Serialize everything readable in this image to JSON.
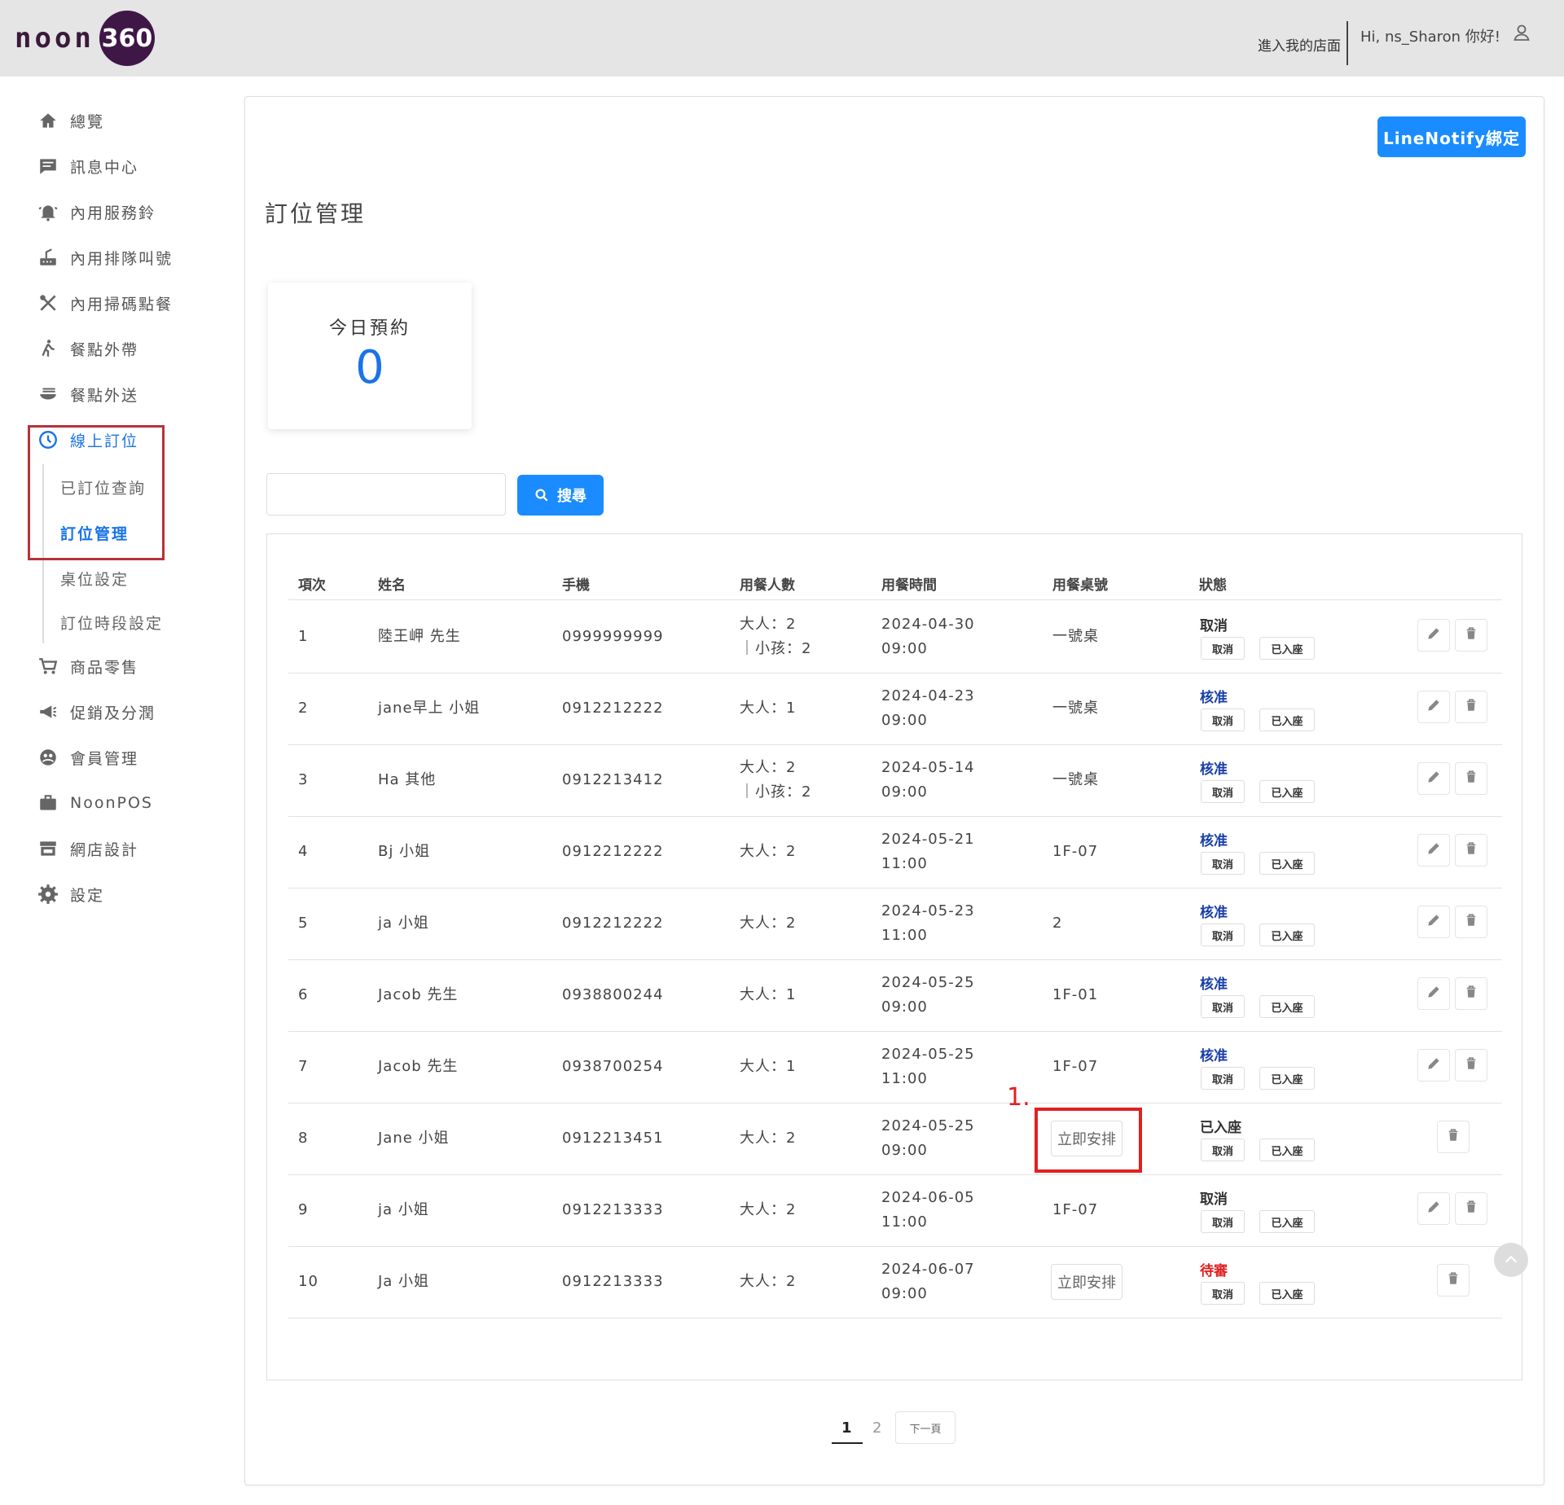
{
  "header": {
    "logo_text": "noon",
    "logo_badge": "360",
    "store_link": "進入我的店面",
    "greeting": "Hi, ns_Sharon 你好!"
  },
  "sidebar": {
    "items": [
      {
        "label": "總覽",
        "icon": "home-icon"
      },
      {
        "label": "訊息中心",
        "icon": "message-icon"
      },
      {
        "label": "內用服務鈴",
        "icon": "bell-icon"
      },
      {
        "label": "內用排隊叫號",
        "icon": "queue-icon"
      },
      {
        "label": "內用掃碼點餐",
        "icon": "utensils-icon"
      },
      {
        "label": "餐點外帶",
        "icon": "walk-icon"
      },
      {
        "label": "餐點外送",
        "icon": "bowl-icon"
      },
      {
        "label": "線上訂位",
        "icon": "clock-icon"
      },
      {
        "label": "商品零售",
        "icon": "cart-icon"
      },
      {
        "label": "促銷及分潤",
        "icon": "megaphone-icon"
      },
      {
        "label": "會員管理",
        "icon": "member-icon"
      },
      {
        "label": "NoonPOS",
        "icon": "briefcase-icon"
      },
      {
        "label": "網店設計",
        "icon": "store-icon"
      },
      {
        "label": "設定",
        "icon": "gear-icon"
      }
    ],
    "sub_items": [
      "已訂位查詢",
      "訂位管理",
      "桌位設定",
      "訂位時段設定"
    ]
  },
  "main": {
    "line_button": "LineNotify綁定",
    "title": "訂位管理",
    "today_label": "今日預約",
    "today_value": "0",
    "search_placeholder": "",
    "search_button": "搜尋"
  },
  "table": {
    "headers": [
      "項次",
      "姓名",
      "手機",
      "用餐人數",
      "用餐時間",
      "用餐桌號",
      "狀態"
    ],
    "cancel_label": "取消",
    "seated_label": "已入座",
    "arrange_label": "立即安排",
    "rows": [
      {
        "no": "1",
        "name": "陸王岬 先生",
        "phone": "0999999999",
        "party1": "大人：2",
        "party2": "｜小孩：2",
        "date": "2024-04-30",
        "time": "09:00",
        "table": "一號桌",
        "status": "取消",
        "status_color": "#333333"
      },
      {
        "no": "2",
        "name": "jane早上 小姐",
        "phone": "0912212222",
        "party1": "大人：1",
        "party2": "",
        "date": "2024-04-23",
        "time": "09:00",
        "table": "一號桌",
        "status": "核准",
        "status_color": "#1a3fa8"
      },
      {
        "no": "3",
        "name": "Ha 其他",
        "phone": "0912213412",
        "party1": "大人：2",
        "party2": "｜小孩：2",
        "date": "2024-05-14",
        "time": "09:00",
        "table": "一號桌",
        "status": "核准",
        "status_color": "#1a3fa8"
      },
      {
        "no": "4",
        "name": "Bj 小姐",
        "phone": "0912212222",
        "party1": "大人：2",
        "party2": "",
        "date": "2024-05-21",
        "time": "11:00",
        "table": "1F-07",
        "status": "核准",
        "status_color": "#1a3fa8"
      },
      {
        "no": "5",
        "name": "ja 小姐",
        "phone": "0912212222",
        "party1": "大人：2",
        "party2": "",
        "date": "2024-05-23",
        "time": "11:00",
        "table": "2",
        "status": "核准",
        "status_color": "#1a3fa8"
      },
      {
        "no": "6",
        "name": "Jacob 先生",
        "phone": "0938800244",
        "party1": "大人：1",
        "party2": "",
        "date": "2024-05-25",
        "time": "09:00",
        "table": "1F-01",
        "status": "核准",
        "status_color": "#1a3fa8"
      },
      {
        "no": "7",
        "name": "Jacob 先生",
        "phone": "0938700254",
        "party1": "大人：1",
        "party2": "",
        "date": "2024-05-25",
        "time": "11:00",
        "table": "1F-07",
        "status": "核准",
        "status_color": "#1a3fa8"
      },
      {
        "no": "8",
        "name": "Jane 小姐",
        "phone": "0912213451",
        "party1": "大人：2",
        "party2": "",
        "date": "2024-05-25",
        "time": "09:00",
        "table": "",
        "status": "已入座",
        "status_color": "#333333"
      },
      {
        "no": "9",
        "name": "ja 小姐",
        "phone": "0912213333",
        "party1": "大人：2",
        "party2": "",
        "date": "2024-06-05",
        "time": "11:00",
        "table": "1F-07",
        "status": "取消",
        "status_color": "#333333"
      },
      {
        "no": "10",
        "name": "Ja 小姐",
        "phone": "0912213333",
        "party1": "大人：2",
        "party2": "",
        "date": "2024-06-07",
        "time": "09:00",
        "table": "",
        "status": "待審",
        "status_color": "#e02020"
      }
    ]
  },
  "annotation": {
    "label": "1."
  },
  "pagination": {
    "pages": [
      "1",
      "2"
    ],
    "current": "1",
    "next_label": "下一頁"
  }
}
